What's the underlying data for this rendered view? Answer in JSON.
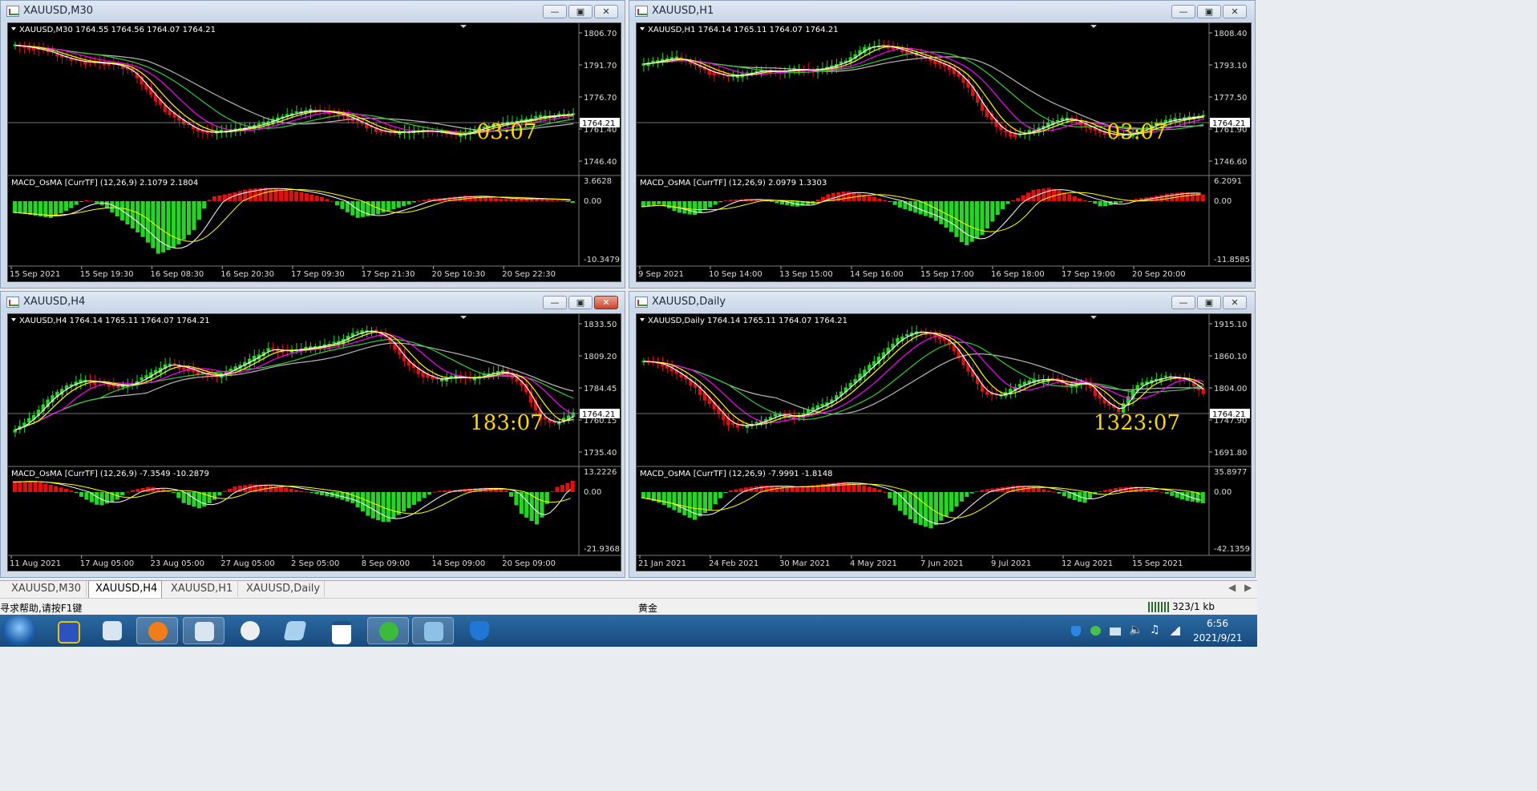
{
  "windows": [
    {
      "title": "XAUUSD,M30",
      "header": "XAUUSD,M30  1764.55 1764.56 1764.07 1764.21",
      "price_ticks": [
        "1806.70",
        "1791.70",
        "1776.70",
        "1761.40",
        "1746.40"
      ],
      "current_price": "1764.21",
      "countdown": "03:07",
      "macd_header": "MACD_OsMA [CurrTF] (12,26,9) 2.1079 2.1804",
      "macd_ticks": [
        "3.6628",
        "0.00",
        "-10.3479"
      ],
      "time_labels": [
        "15 Sep 2021",
        "15 Sep 19:30",
        "16 Sep 08:30",
        "16 Sep 20:30",
        "17 Sep 09:30",
        "17 Sep 21:30",
        "20 Sep 10:30",
        "20 Sep 22:30"
      ],
      "price_path": [
        0.1,
        0.12,
        0.15,
        0.2,
        0.23,
        0.24,
        0.25,
        0.3,
        0.45,
        0.6,
        0.7,
        0.78,
        0.8,
        0.78,
        0.76,
        0.73,
        0.68,
        0.64,
        0.62,
        0.63,
        0.66,
        0.72,
        0.78,
        0.8,
        0.79,
        0.78,
        0.8,
        0.82,
        0.78,
        0.74,
        0.72,
        0.7,
        0.67,
        0.66,
        0.65
      ],
      "hist": [
        -0.2,
        -0.25,
        -0.3,
        -0.15,
        0.05,
        -0.1,
        -0.35,
        -0.6,
        -0.95,
        -0.8,
        -0.5,
        0.2,
        0.35,
        0.55,
        0.6,
        0.5,
        0.4,
        0.2,
        -0.1,
        -0.3,
        -0.25,
        -0.15,
        -0.05,
        0.1,
        0.15,
        0.25,
        0.2,
        0.1,
        0.1,
        0.12,
        0.05,
        -0.03
      ]
    },
    {
      "title": "XAUUSD,H1",
      "header": "XAUUSD,H1  1764.14 1765.11 1764.07 1764.21",
      "price_ticks": [
        "1808.40",
        "1793.10",
        "1777.50",
        "1761.90",
        "1746.60"
      ],
      "current_price": "1764.21",
      "countdown": "03:07",
      "macd_header": "MACD_OsMA [CurrTF] (12,26,9) 2.0979 1.3303",
      "macd_ticks": [
        "6.2091",
        "0.00",
        "-11.8585"
      ],
      "time_labels": [
        "9 Sep 2021",
        "10 Sep 14:00",
        "13 Sep 15:00",
        "14 Sep 16:00",
        "15 Sep 17:00",
        "16 Sep 18:00",
        "17 Sep 19:00",
        "20 Sep 20:00"
      ],
      "price_path": [
        0.25,
        0.22,
        0.2,
        0.26,
        0.32,
        0.35,
        0.33,
        0.3,
        0.31,
        0.29,
        0.3,
        0.27,
        0.22,
        0.12,
        0.1,
        0.13,
        0.18,
        0.22,
        0.28,
        0.4,
        0.62,
        0.78,
        0.82,
        0.78,
        0.72,
        0.68,
        0.74,
        0.8,
        0.82,
        0.8,
        0.74,
        0.7,
        0.68,
        0.66
      ],
      "hist": [
        -0.1,
        -0.05,
        -0.2,
        -0.25,
        -0.1,
        0.05,
        0.1,
        0.05,
        -0.05,
        -0.1,
        -0.05,
        0.35,
        0.45,
        0.3,
        0.1,
        -0.1,
        -0.2,
        -0.3,
        -0.5,
        -0.8,
        -0.6,
        -0.2,
        0.1,
        0.5,
        0.6,
        0.35,
        0.05,
        -0.1,
        -0.05,
        0.1,
        0.2,
        0.35,
        0.4,
        0.3
      ]
    },
    {
      "title": "XAUUSD,H4",
      "header": "XAUUSD,H4  1764.14 1765.11 1764.07 1764.21",
      "price_ticks": [
        "1833.50",
        "1809.20",
        "1784.45",
        "1760.15",
        "1735.40"
      ],
      "current_price": "1764.21",
      "countdown": "183:07",
      "macd_header": "MACD_OsMA [CurrTF] (12,26,9) -7.3549 -10.2879",
      "macd_ticks": [
        "13.2226",
        "0.00",
        "-21.9368"
      ],
      "time_labels": [
        "11 Aug 2021",
        "17 Aug 05:00",
        "23 Aug 05:00",
        "27 Aug 05:00",
        "2 Sep 05:00",
        "8 Sep 09:00",
        "14 Sep 09:00",
        "20 Sep 09:00"
      ],
      "price_path": [
        0.85,
        0.75,
        0.6,
        0.5,
        0.45,
        0.47,
        0.5,
        0.48,
        0.4,
        0.32,
        0.35,
        0.4,
        0.42,
        0.35,
        0.28,
        0.2,
        0.22,
        0.2,
        0.18,
        0.15,
        0.08,
        0.05,
        0.12,
        0.3,
        0.4,
        0.45,
        0.42,
        0.44,
        0.4,
        0.38,
        0.5,
        0.75,
        0.8,
        0.72
      ],
      "hist": [
        0.45,
        0.5,
        0.35,
        0.15,
        -0.1,
        -0.25,
        -0.15,
        0.1,
        0.25,
        0.1,
        -0.2,
        -0.3,
        -0.1,
        0.25,
        0.35,
        0.3,
        0.2,
        0.05,
        -0.05,
        -0.1,
        -0.2,
        -0.45,
        -0.55,
        -0.35,
        -0.15,
        0.05,
        0.1,
        0.15,
        0.2,
        0.1,
        -0.4,
        -0.6,
        0.2,
        0.5
      ]
    },
    {
      "title": "XAUUSD,Daily",
      "header": "XAUUSD,Daily  1764.14 1765.11 1764.07 1764.21",
      "price_ticks": [
        "1915.10",
        "1860.10",
        "1804.00",
        "1747.90",
        "1691.80"
      ],
      "current_price": "1764.21",
      "countdown": "1323:07",
      "macd_header": "MACD_OsMA [CurrTF] (12,26,9) -7.9991 -1.8148",
      "macd_ticks": [
        "35.8977",
        "0.00",
        "-42.1359"
      ],
      "time_labels": [
        "21 Jan 2021",
        "24 Feb 2021",
        "30 Mar 2021",
        "4 May 2021",
        "7 Jun 2021",
        "9 Jul 2021",
        "12 Aug 2021",
        "15 Sep 2021"
      ],
      "price_path": [
        0.3,
        0.32,
        0.4,
        0.5,
        0.65,
        0.8,
        0.82,
        0.78,
        0.72,
        0.75,
        0.68,
        0.62,
        0.5,
        0.38,
        0.25,
        0.12,
        0.06,
        0.08,
        0.15,
        0.35,
        0.55,
        0.58,
        0.5,
        0.45,
        0.44,
        0.5,
        0.46,
        0.62,
        0.7,
        0.5,
        0.45,
        0.42,
        0.45,
        0.55
      ],
      "hist": [
        -0.1,
        -0.2,
        -0.35,
        -0.5,
        -0.3,
        0.05,
        0.2,
        0.3,
        0.25,
        0.2,
        0.3,
        0.4,
        0.45,
        0.3,
        0.1,
        -0.3,
        -0.55,
        -0.65,
        -0.4,
        -0.1,
        0.1,
        0.2,
        0.3,
        0.25,
        0.05,
        -0.1,
        -0.2,
        0.05,
        0.2,
        0.25,
        0.1,
        -0.05,
        -0.15,
        -0.2
      ]
    }
  ],
  "tabs": [
    "XAUUSD,M30",
    "XAUUSD,H4",
    "XAUUSD,H1",
    "XAUUSD,Daily"
  ],
  "status": {
    "help": "寻求帮助,请按F1键",
    "profile": "黄金",
    "traffic": "323/1 kb"
  },
  "clock": {
    "time": "6:56",
    "date": "2021/9/21"
  },
  "colors": {
    "bull": "#26d426",
    "bear": "#e01010",
    "ma_yellow": "#ffff00",
    "ma_magenta": "#ff00ff",
    "ma_green": "#33cc33",
    "ma_white": "#ffffff",
    "ma_gray": "#b8b8b8",
    "countdown": "#ffd700"
  }
}
